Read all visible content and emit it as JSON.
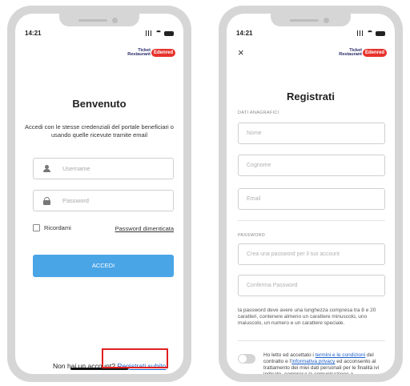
{
  "left": {
    "status_time": "14:21",
    "logo_line1": "Ticket",
    "logo_line2": "Restaurant",
    "logo_badge": "Edenred",
    "title": "Benvenuto",
    "subtitle": "Accedi con le stesse credenziali del portale beneficiari o usando quelle ricevute tramite email",
    "username_placeholder": "Username",
    "password_placeholder": "Password",
    "remember_label": "Ricordami",
    "forgot_link": "Password dimenticata",
    "login_button": "ACCEDI",
    "no_account_text": "Non hai un account? ",
    "register_link": "Registrati subito"
  },
  "right": {
    "status_time": "14:21",
    "logo_line1": "Ticket",
    "logo_line2": "Restaurant",
    "logo_badge": "Edenred",
    "close_icon": "×",
    "title": "Registrati",
    "section_personal": "DATI ANAGRAFICI",
    "nome_placeholder": "Nome",
    "cognome_placeholder": "Cognome",
    "email_placeholder": "Email",
    "section_password": "PASSWORD",
    "password_placeholder": "Crea una password per il tuo account",
    "confirm_placeholder": "Conferma Password",
    "password_note": "la password deve avere una lunghezza compresa tra 8 e 20 caratteri, contenere almeno un carattere minuscolo, uno maiuscolo, un numero e un carattere speciale.",
    "consent_prefix": "Ho letto ed accettato i ",
    "consent_terms": "termini e le condizioni",
    "consent_middle": " del contratto e l'",
    "consent_privacy": "informativa privacy",
    "consent_suffix": " ed acconsento al trattamento dei miei dati personali per le finalità ivi indicate, compresa la comunicazione a"
  },
  "colors": {
    "accent_button": "#4aa5e6",
    "link": "#1a5fc9",
    "highlight_box": "#e02020",
    "logo_red": "#e7332c"
  }
}
